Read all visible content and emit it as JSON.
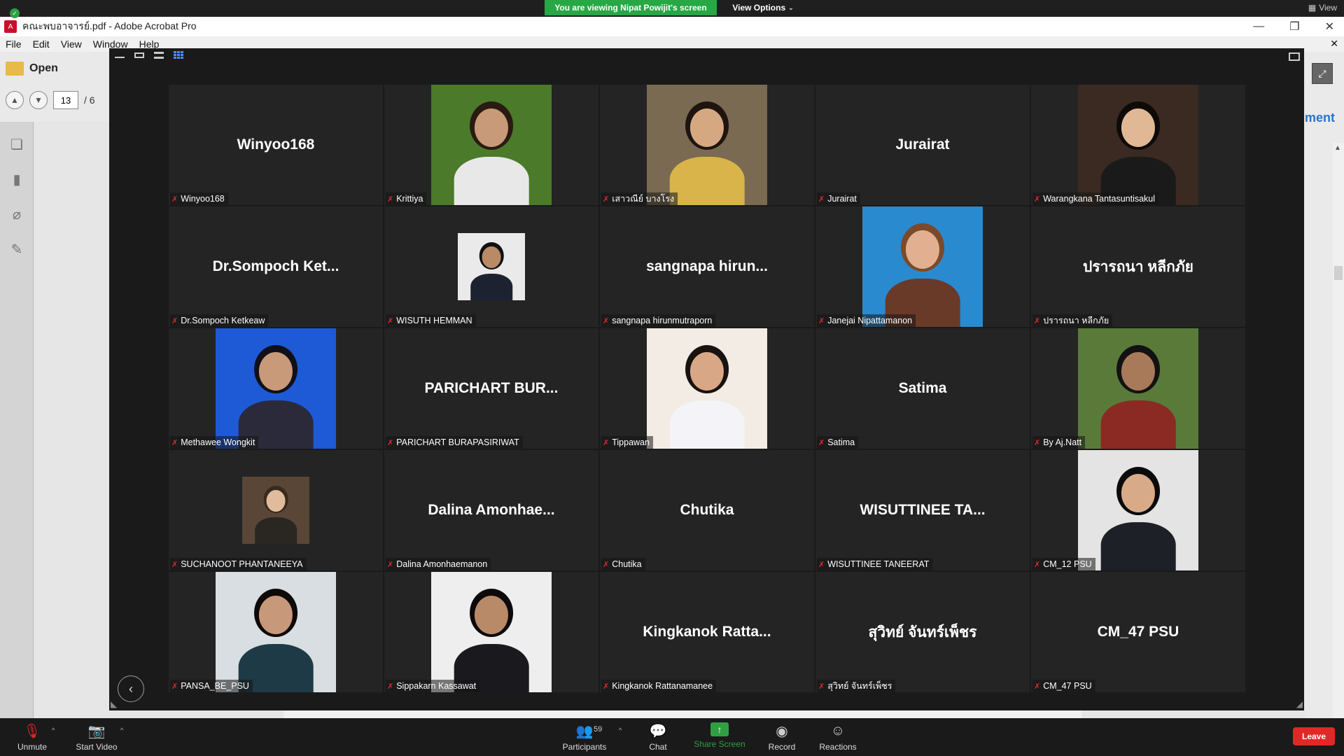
{
  "zoom_top": {
    "share_banner": "You are viewing Nipat Powijit's screen",
    "view_options": "View Options",
    "view_right": "View"
  },
  "acrobat": {
    "title": "คณะพบอาจารย์.pdf - Adobe Acrobat Pro",
    "menu": [
      "File",
      "Edit",
      "View",
      "Window",
      "Help"
    ],
    "open_label": "Open",
    "page_current": "13",
    "page_sep": "/ 6",
    "right_panel_label": "ment"
  },
  "participants": [
    {
      "display": "Winyoo168",
      "label": "Winyoo168",
      "video": false
    },
    {
      "display": "",
      "label": "Krittiya",
      "video": true,
      "size": "full",
      "bg": "#4a7a2a",
      "accent": "#e8e8e8",
      "skin": "#c89a78",
      "hair": "#2a1a12"
    },
    {
      "display": "",
      "label": "เสาวณีย์ บางโรง",
      "video": true,
      "size": "full",
      "bg": "#7a6a52",
      "accent": "#d8b44a",
      "skin": "#d6a882",
      "hair": "#1e1410"
    },
    {
      "display": "Jurairat",
      "label": "Jurairat",
      "video": false
    },
    {
      "display": "",
      "label": "Warangkana Tantasuntisakul",
      "video": true,
      "size": "full",
      "bg": "#3a2a22",
      "accent": "#1a1a1a",
      "skin": "#e0b896",
      "hair": "#0e0a08"
    },
    {
      "display": "Dr.Sompoch Ket...",
      "label": "Dr.Sompoch Ketkeaw",
      "video": false
    },
    {
      "display": "",
      "label": "WISUTH HEMMAN",
      "video": true,
      "size": "small",
      "bg": "#eaeaea",
      "accent": "#1c2230",
      "skin": "#b88a66",
      "hair": "#101010"
    },
    {
      "display": "sangnapa hirun...",
      "label": "sangnapa hirunmutraporn",
      "video": false
    },
    {
      "display": "",
      "label": "Janejai Nipattamanon",
      "video": true,
      "size": "full",
      "bg": "#2a8ad0",
      "accent": "#6a3a28",
      "skin": "#e2b090",
      "hair": "#7a4a2a"
    },
    {
      "display": "ปรารถนา หลีกภัย",
      "label": "ปรารถนา หลีกภัย",
      "video": false
    },
    {
      "display": "",
      "label": "Methawee Wongkit",
      "video": true,
      "size": "full",
      "bg": "#1e5ad6",
      "accent": "#2a2a3a",
      "skin": "#c89a7a",
      "hair": "#101018"
    },
    {
      "display": "PARICHART BUR...",
      "label": "PARICHART BURAPASIRIWAT",
      "video": false
    },
    {
      "display": "",
      "label": "Tippawan",
      "video": true,
      "size": "full",
      "bg": "#f2ece4",
      "accent": "#f4f4f8",
      "skin": "#d8a886",
      "hair": "#181210"
    },
    {
      "display": "Satima",
      "label": "Satima",
      "video": false
    },
    {
      "display": "",
      "label": "By Aj.Natt",
      "video": true,
      "size": "full",
      "bg": "#5a7a3a",
      "accent": "#8a2a22",
      "skin": "#a87a5a",
      "hair": "#121212"
    },
    {
      "display": "",
      "label": "SUCHANOOT PHANTANEEYA",
      "video": true,
      "size": "small",
      "bg": "#5a4636",
      "accent": "#2a2622",
      "skin": "#e0bc9c",
      "hair": "#3a2a1e"
    },
    {
      "display": "Dalina Amonhae...",
      "label": "Dalina Amonhaemanon",
      "video": false
    },
    {
      "display": "Chutika",
      "label": "Chutika",
      "video": false
    },
    {
      "display": "WISUTTINEE TA...",
      "label": "WISUTTINEE TANEERAT",
      "video": false
    },
    {
      "display": "",
      "label": "CM_12 PSU",
      "video": true,
      "size": "full",
      "bg": "#e4e4e4",
      "accent": "#1e2028",
      "skin": "#d8aa88",
      "hair": "#0c0a0a"
    },
    {
      "display": "",
      "label": "PANSA_BE_PSU",
      "video": true,
      "size": "full",
      "bg": "#d8dee2",
      "accent": "#1e3a46",
      "skin": "#c8987a",
      "hair": "#0e0a08"
    },
    {
      "display": "",
      "label": "Sippakarn Kassawat",
      "video": true,
      "size": "full",
      "bg": "#eeeeee",
      "accent": "#1a1a1e",
      "skin": "#b88a68",
      "hair": "#0c0a0a"
    },
    {
      "display": "Kingkanok Ratta...",
      "label": "Kingkanok Rattanamanee",
      "video": false
    },
    {
      "display": "สุวิทย์ จันทร์เพ็ชร",
      "label": "สุวิทย์ จันทร์เพ็ชร",
      "video": false
    },
    {
      "display": "CM_47 PSU",
      "label": "CM_47 PSU",
      "video": false
    }
  ],
  "toolbar": {
    "unmute": "Unmute",
    "start_video": "Start Video",
    "participants": "Participants",
    "participants_count": "59",
    "chat": "Chat",
    "share_screen": "Share Screen",
    "record": "Record",
    "reactions": "Reactions",
    "leave": "Leave"
  },
  "colors": {
    "share_green": "#28a745",
    "leave_red": "#e02828",
    "tile_bg": "#242424",
    "accent_blue": "#4a8cff"
  }
}
